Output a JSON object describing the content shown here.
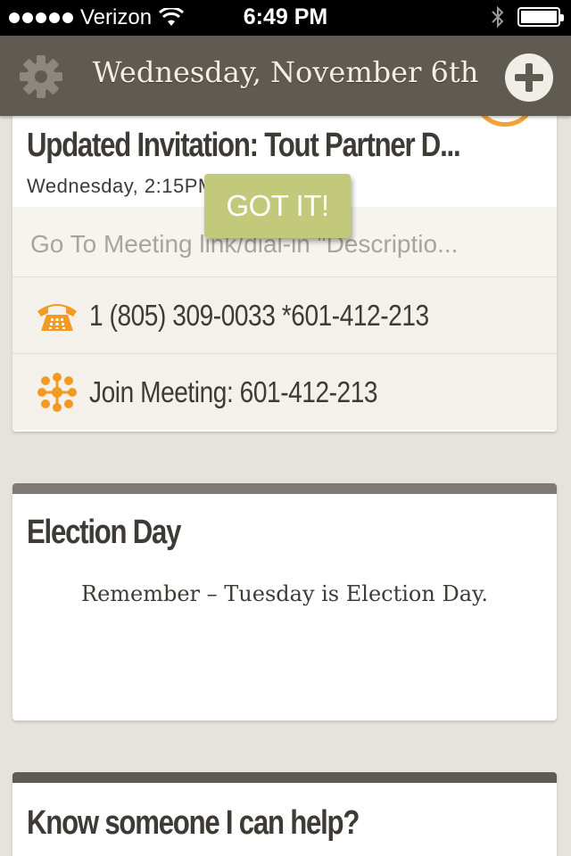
{
  "status_bar": {
    "carrier": "Verizon",
    "time": "6:49 PM",
    "battery_level": 1.0
  },
  "header": {
    "title": "Wednesday, November 6th",
    "settings_icon": "gear-icon",
    "add_icon": "plus-circle-icon"
  },
  "event_card": {
    "title": "Updated Invitation: Tout Partner D...",
    "time": "Wednesday, 2:15PM - 3:00PM",
    "description": "Go To Meeting link/dial-in \"Descriptio...",
    "phone": "1 (805) 309-0033 *601-412-213",
    "join": "Join Meeting: 601-412-213",
    "accent_color": "#f2a33a"
  },
  "reminder_card": {
    "title": "Election Day",
    "message": "Remember – Tuesday is Election Day.",
    "button_label": "GOT IT!",
    "button_color": "#c3c97b"
  },
  "help_card": {
    "title": "Know someone I can help?"
  }
}
